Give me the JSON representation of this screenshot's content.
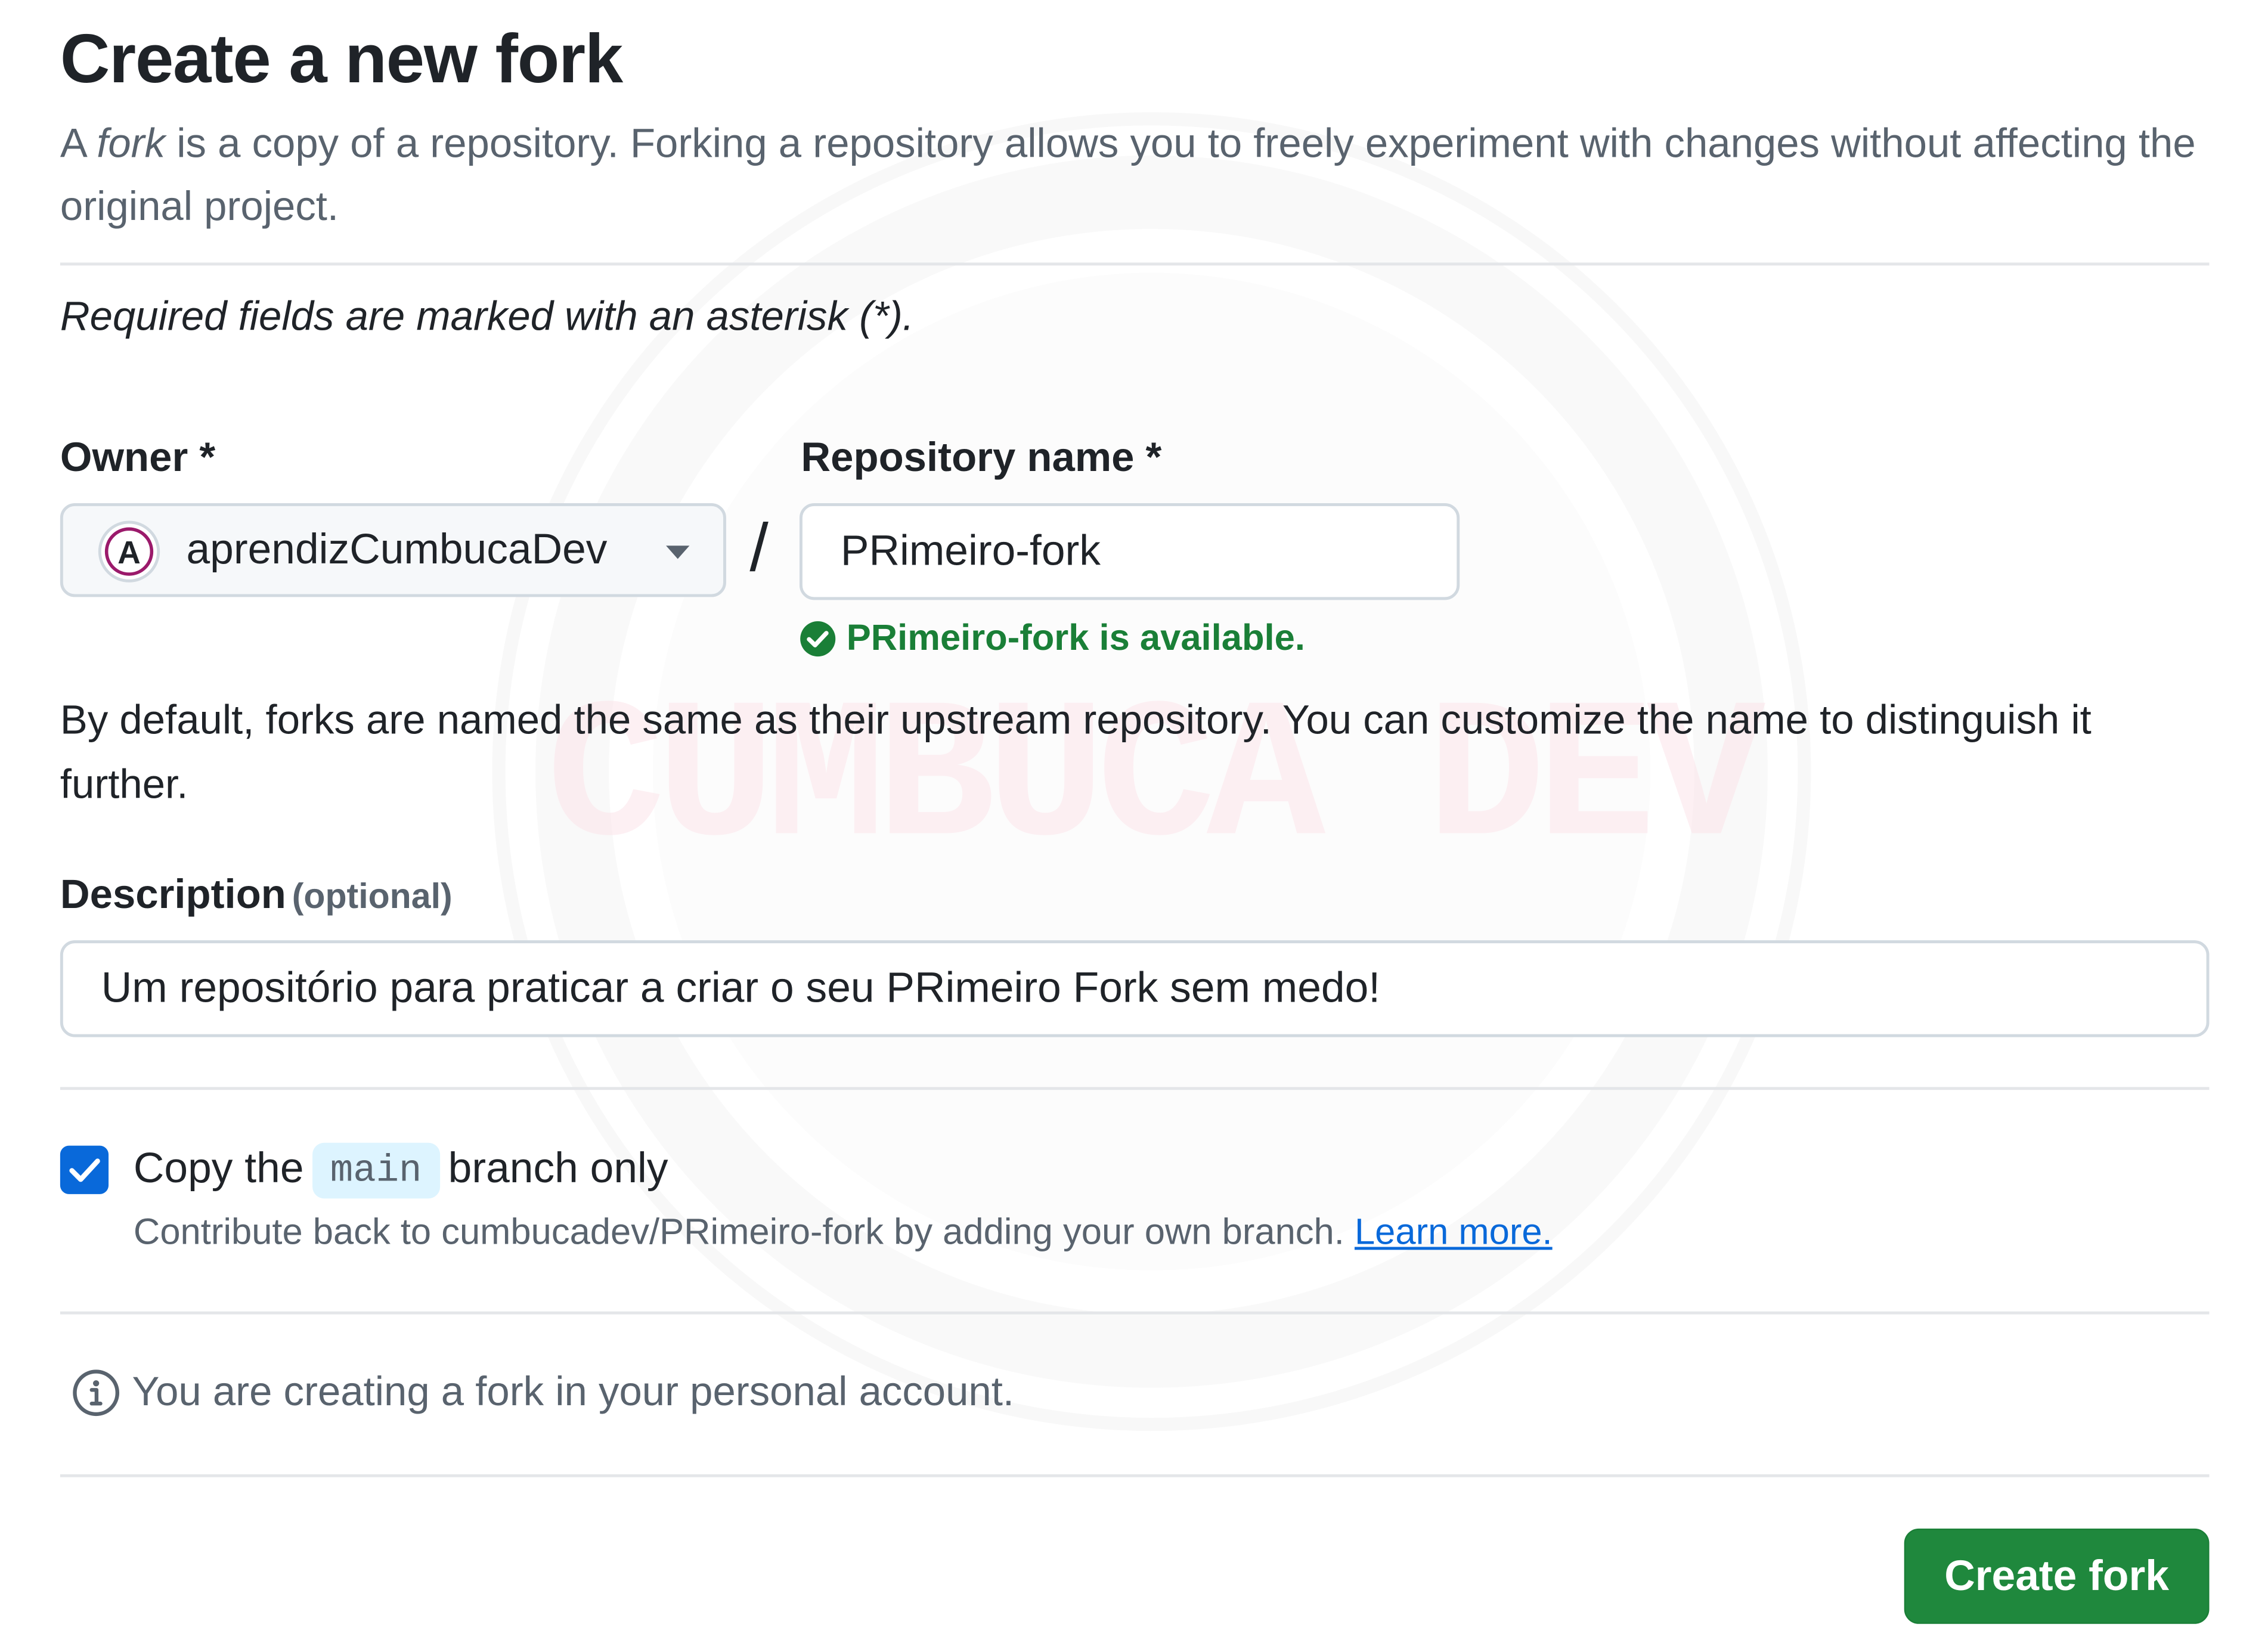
{
  "header": {
    "title": "Create a new fork",
    "subtitle_prefix": "A ",
    "subtitle_em": "fork",
    "subtitle_rest": " is a copy of a repository. Forking a repository allows you to freely experiment with changes without affecting the original project."
  },
  "required_note": "Required fields are marked with an asterisk (*).",
  "owner": {
    "label": "Owner *",
    "value": "aprendizCumbucaDev",
    "avatar_letter": "A"
  },
  "separator": "/",
  "repository": {
    "label": "Repository name *",
    "value": "PRimeiro-fork",
    "availability": "PRimeiro-fork is available."
  },
  "default_note": "By default, forks are named the same as their upstream repository. You can customize the name to distinguish it further.",
  "description": {
    "label": "Description",
    "optional": "(optional)",
    "value": "Um repositório para praticar a criar o seu PRimeiro Fork sem medo!"
  },
  "copy_branch": {
    "checked": true,
    "prefix": "Copy the",
    "branch": "main",
    "suffix": "branch only",
    "help_text": "Contribute back to cumbucadev/PRimeiro-fork by adding your own branch.",
    "learn_more": "Learn more."
  },
  "info": "You are creating a fork in your personal account.",
  "submit_label": "Create fork",
  "watermark_text": "CUMBUCA DEV",
  "colors": {
    "success": "#1a7f37",
    "button": "#1f883d",
    "accent": "#0969da",
    "muted": "#59636e",
    "border": "#d1d9e0"
  },
  "icons": {
    "owner_avatar": "avatar-icon",
    "owner_caret": "caret-down-icon",
    "availability": "check-circle-fill-icon",
    "checkbox": "checkmark-icon",
    "info": "info-icon"
  }
}
